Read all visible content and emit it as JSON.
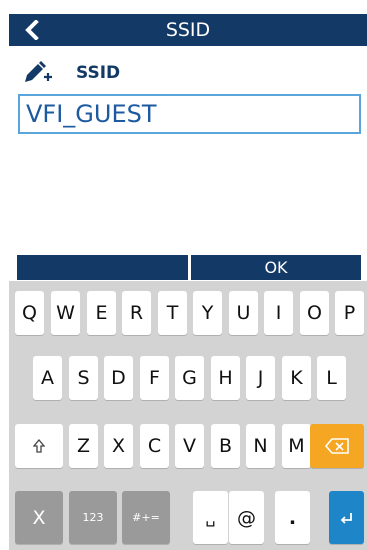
{
  "header": {
    "title": "SSID"
  },
  "field": {
    "label": "SSID",
    "value": "VFI_GUEST"
  },
  "actions": {
    "ok_label": "OK"
  },
  "keyboard": {
    "row1": [
      "Q",
      "W",
      "E",
      "R",
      "T",
      "Y",
      "U",
      "I",
      "O",
      "P"
    ],
    "row2": [
      "A",
      "S",
      "D",
      "F",
      "G",
      "H",
      "J",
      "K",
      "L"
    ],
    "row3": [
      "Z",
      "X",
      "C",
      "V",
      "B",
      "N",
      "M"
    ],
    "row4": {
      "close": "X",
      "numbers": "123",
      "symbols": "#+=",
      "space": "␣",
      "at": "@",
      "dot": "."
    },
    "colors": {
      "bar": "#133a66",
      "backspace": "#f5a623",
      "enter": "#1e86c8",
      "field_border": "#5aa5dc"
    },
    "icons": {
      "shift": "shift-icon",
      "backspace": "backspace-icon",
      "enter": "enter-icon"
    }
  }
}
